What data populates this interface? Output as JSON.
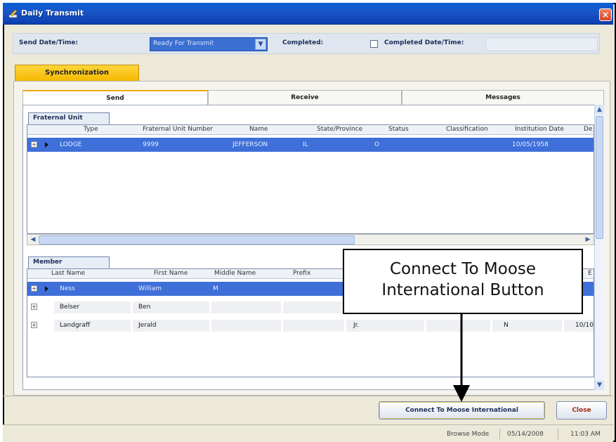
{
  "window": {
    "title": "Daily Transmit"
  },
  "header": {
    "send_datetime_label": "Send Date/Time:",
    "status_value": "Ready For Transmit",
    "completed_label": "Completed:",
    "completed_checked": false,
    "completed_datetime_label": "Completed Date/Time:"
  },
  "sync_tab": {
    "label": "Synchronization"
  },
  "tabs": [
    {
      "label": "Send",
      "active": true
    },
    {
      "label": "Receive",
      "active": false
    },
    {
      "label": "Messages",
      "active": false
    }
  ],
  "fraternal_unit": {
    "section_label": "Fraternal Unit",
    "columns": [
      "Type",
      "Fraternal Unit Number",
      "Name",
      "State/Province",
      "Status",
      "Classification",
      "Institution Date",
      "De"
    ],
    "rows": [
      {
        "type": "LODGE",
        "number": "9999",
        "name": "JEFFERSON",
        "state": "IL",
        "status": "O",
        "classification": "",
        "institution_date": "10/05/1958",
        "de": ""
      }
    ]
  },
  "member": {
    "section_label": "Member",
    "columns": [
      "Last Name",
      "First Name",
      "Middle Name",
      "Prefix",
      "E"
    ],
    "rows": [
      {
        "last": "Ness",
        "first": "William",
        "middle": "M",
        "prefix": "",
        "suffix": "",
        "c6": "",
        "c7": "",
        "last_col": ""
      },
      {
        "last": "Belser",
        "first": "Ben",
        "middle": "",
        "prefix": "",
        "suffix": "",
        "c6": "",
        "c7": "",
        "last_col": ""
      },
      {
        "last": "Landgraff",
        "first": "Jerald",
        "middle": "",
        "prefix": "",
        "suffix": "Jr.",
        "c6": "",
        "c7": "N",
        "last_col": "10/10"
      }
    ]
  },
  "buttons": {
    "connect_label": "Connect To Moose International",
    "close_label": "Close"
  },
  "statusbar": {
    "mode": "Browse Mode",
    "date": "05/14/2008",
    "time": "11:03 AM"
  },
  "annotation": {
    "line1": "Connect To Moose",
    "line2": "International Button"
  },
  "icons": {
    "title": "pencil-icon",
    "close": "close-icon",
    "dropdown": "chevron-down-icon",
    "expand": "plus-icon",
    "row_indicator": "triangle-right-icon"
  },
  "colors": {
    "titlebar": "#0b3fb0",
    "sync_tab": "#f4b800",
    "selected_row": "#3f6fd8"
  }
}
